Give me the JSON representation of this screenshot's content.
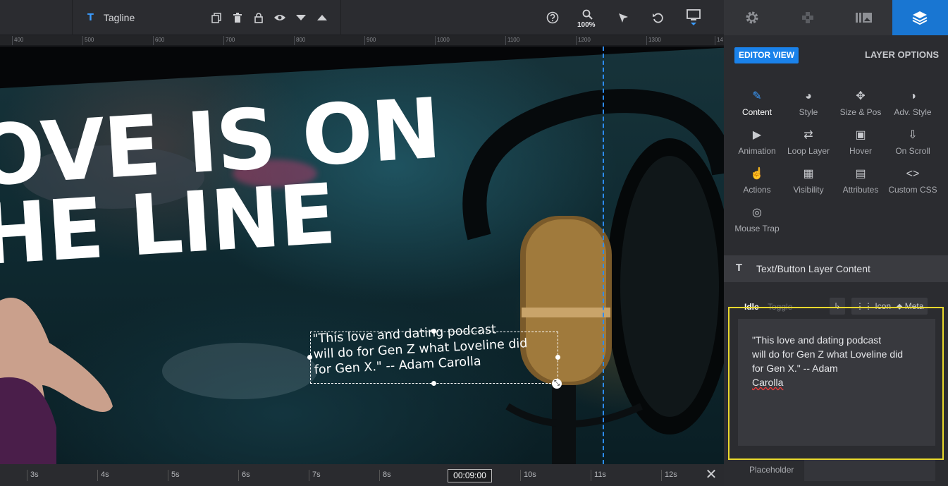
{
  "toolbar": {
    "layer_type_icon": "T",
    "layer_name": "Tagline",
    "tools": [
      "duplicate-icon",
      "trash-icon",
      "lock-icon",
      "eye-icon",
      "arrow-down-icon",
      "arrow-up-icon"
    ],
    "zoom_label": "100%"
  },
  "ruler": {
    "ticks": [
      "400",
      "500",
      "600",
      "700",
      "800",
      "900",
      "1000",
      "1100",
      "1200",
      "1300",
      "14"
    ]
  },
  "canvas": {
    "headline_line1": "OVE IS ON",
    "headline_line2": "HE LINE",
    "quote_line1": "\"This love and dating podcast",
    "quote_line2": "will do for Gen Z what Loveline did",
    "quote_line3": "for Gen X.\" -- Adam Carolla"
  },
  "timeline": {
    "ticks": [
      "3s",
      "4s",
      "5s",
      "6s",
      "7s",
      "8s",
      "10s",
      "11s",
      "12s"
    ],
    "current_time": "00:09:00",
    "close": "✕"
  },
  "panel": {
    "tabs": [
      "gear-icon",
      "puzzle-icon",
      "media-icon",
      "layers-icon"
    ],
    "editor_view": "EDITOR VIEW",
    "layer_options": "LAYER OPTIONS",
    "options": [
      {
        "label": "Content",
        "icon": "✎"
      },
      {
        "label": "Style",
        "icon": "◕"
      },
      {
        "label": "Size & Pos",
        "icon": "✥"
      },
      {
        "label": "Adv. Style",
        "icon": "◑"
      },
      {
        "label": "Animation",
        "icon": "▶"
      },
      {
        "label": "Loop Layer",
        "icon": "⇄"
      },
      {
        "label": "Hover",
        "icon": "▣"
      },
      {
        "label": "On Scroll",
        "icon": "⇩"
      },
      {
        "label": "Actions",
        "icon": "☝"
      },
      {
        "label": "Visibility",
        "icon": "▦"
      },
      {
        "label": "Attributes",
        "icon": "▤"
      },
      {
        "label": "Custom CSS",
        "icon": "<>"
      },
      {
        "label": "Mouse Trap",
        "icon": "◎"
      }
    ],
    "section_icon": "T",
    "section_title": "Text/Button Layer Content",
    "subtab_idle": "Idle",
    "subtab_toggle": "Toggle",
    "subtab_arrow": "↳",
    "subtab_icon": "Icon",
    "subtab_meta": "Meta",
    "content_line1": "\"This love and dating podcast",
    "content_line2": "will do for Gen Z what Loveline did",
    "content_line3a": "for Gen X.\" -- Adam ",
    "content_line3b": "Carolla",
    "placeholder_label": "Placeholder"
  }
}
